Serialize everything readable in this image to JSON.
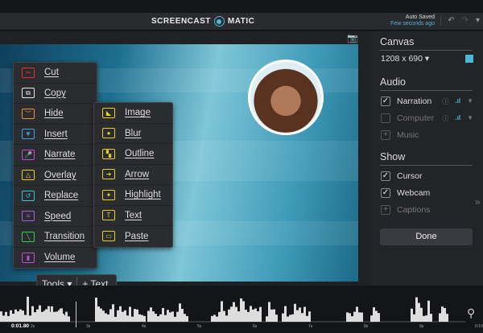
{
  "header": {
    "logo_left": "SCREENCAST",
    "logo_right": "MATIC",
    "saved": "Auto Saved",
    "saved_time": "Few seconds ago",
    "icons": [
      "undo-icon",
      "redo-icon",
      "dropdown-icon"
    ]
  },
  "tools_menu": [
    {
      "label": "Cut",
      "color": "#e0303a",
      "icon": "scissors-icon",
      "glyph": "✂"
    },
    {
      "label": "Copy",
      "color": "#e8e8e8",
      "icon": "copy-icon",
      "glyph": "⧉"
    },
    {
      "label": "Hide",
      "color": "#e8942a",
      "icon": "hide-icon",
      "glyph": "︶"
    },
    {
      "label": "Insert",
      "color": "#3ba4e8",
      "icon": "insert-icon",
      "glyph": "▼"
    },
    {
      "label": "Narrate",
      "color": "#c54ad8",
      "icon": "microphone-icon",
      "glyph": "🎤"
    },
    {
      "label": "Overlay",
      "color": "#e8d020",
      "icon": "overlay-icon",
      "glyph": "△"
    },
    {
      "label": "Replace",
      "color": "#30c8e0",
      "icon": "replace-icon",
      "glyph": "↺"
    },
    {
      "label": "Speed",
      "color": "#a060e0",
      "icon": "speed-icon",
      "glyph": "≡"
    },
    {
      "label": "Transition",
      "color": "#30d050",
      "icon": "transition-icon",
      "glyph": "╲"
    },
    {
      "label": "Volume",
      "color": "#c54ad8",
      "icon": "volume-icon",
      "glyph": "▮"
    }
  ],
  "overlay_menu": [
    {
      "label": "Image",
      "icon": "image-icon",
      "glyph": "◣"
    },
    {
      "label": "Blur",
      "icon": "blur-icon",
      "glyph": "●"
    },
    {
      "label": "Outline",
      "icon": "outline-icon",
      "glyph": "▚"
    },
    {
      "label": "Arrow",
      "icon": "arrow-icon",
      "glyph": "➜"
    },
    {
      "label": "Highlight",
      "icon": "highlight-icon",
      "glyph": "✦"
    },
    {
      "label": "Text",
      "icon": "text-icon",
      "glyph": "T"
    },
    {
      "label": "Paste",
      "icon": "paste-icon",
      "glyph": "▭"
    }
  ],
  "overlay_color": "#e8d020",
  "toolbar": {
    "tools": "Tools ▾",
    "text": "+ Text"
  },
  "panel": {
    "canvas_title": "Canvas",
    "canvas_size": "1208 x 690 ▾",
    "canvas_color": "#4fb6d8",
    "audio_title": "Audio",
    "narration": {
      "label": "Narration",
      "checked": true
    },
    "computer": {
      "label": "Computer",
      "checked": false
    },
    "music": "Music",
    "show_title": "Show",
    "cursor": {
      "label": "Cursor",
      "checked": true
    },
    "webcam": {
      "label": "Webcam",
      "checked": true
    },
    "captions": "Captions",
    "done": "Done"
  },
  "timeline": {
    "current": "0:01.80",
    "ticks": [
      "2s",
      "3s",
      "4s",
      "5s",
      "6s",
      "7s",
      "8s",
      "9s",
      "0:10"
    ]
  }
}
